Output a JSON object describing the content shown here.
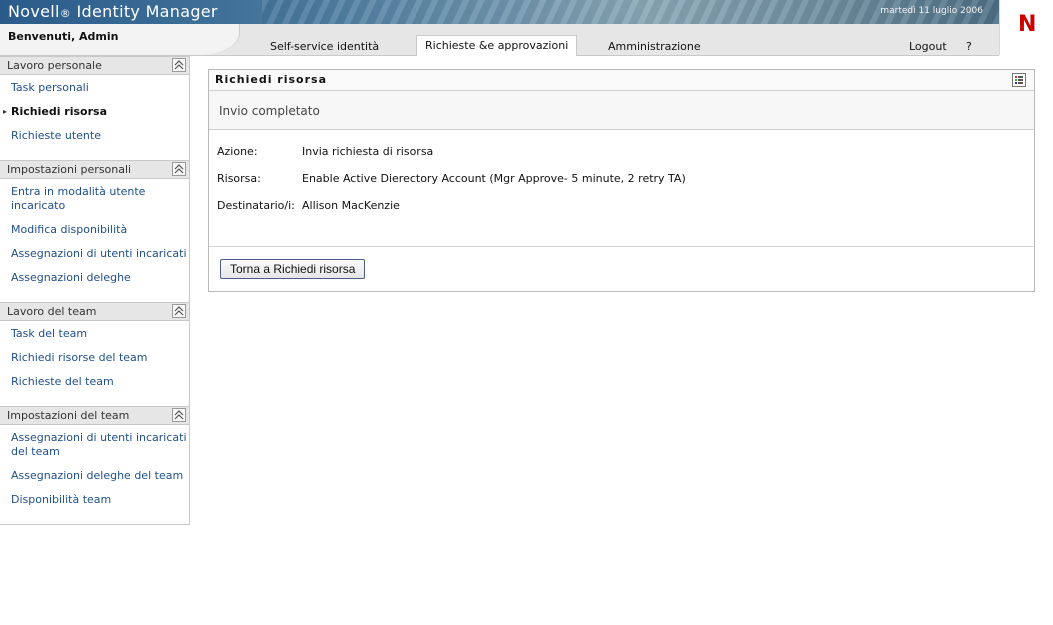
{
  "app": {
    "brand_main": "Novell",
    "brand_reg": "®",
    "brand_rest": " Identity Manager",
    "date": "martedì 11 luglio 2006",
    "logo_letter": "N"
  },
  "header": {
    "welcome": "Benvenuti, Admin",
    "tabs": [
      {
        "label": "Self-service identità"
      },
      {
        "label": "Richieste &e approvazioni"
      },
      {
        "label": "Amministrazione"
      }
    ],
    "logout": "Logout",
    "help": "?"
  },
  "sidebar": {
    "sections": [
      {
        "title": "Lavoro personale",
        "items": [
          {
            "label": "Task personali"
          },
          {
            "label": "Richiedi risorsa"
          },
          {
            "label": "Richieste utente"
          }
        ]
      },
      {
        "title": "Impostazioni personali",
        "items": [
          {
            "label": "Entra in modalità utente incaricato"
          },
          {
            "label": "Modifica disponibilità"
          },
          {
            "label": "Assegnazioni di utenti incaricati"
          },
          {
            "label": "Assegnazioni deleghe"
          }
        ]
      },
      {
        "title": "Lavoro del team",
        "items": [
          {
            "label": "Task del team"
          },
          {
            "label": "Richiedi risorse del team"
          },
          {
            "label": "Richieste del team"
          }
        ]
      },
      {
        "title": "Impostazioni del team",
        "items": [
          {
            "label": "Assegnazioni di utenti incaricati del team"
          },
          {
            "label": "Assegnazioni deleghe del team"
          },
          {
            "label": "Disponibilità team"
          }
        ]
      }
    ]
  },
  "panel": {
    "title": "Richiedi risorsa",
    "status": "Invio completato",
    "fields": [
      {
        "label": "Azione:",
        "value": "Invia richiesta di risorsa"
      },
      {
        "label": "Risorsa:",
        "value": "Enable Active Dierectory Account (Mgr Approve- 5 minute, 2 retry TA)"
      },
      {
        "label": "Destinatario/i:",
        "value": "Allison MacKenzie"
      }
    ],
    "back_button": "Torna a Richiedi risorsa"
  }
}
